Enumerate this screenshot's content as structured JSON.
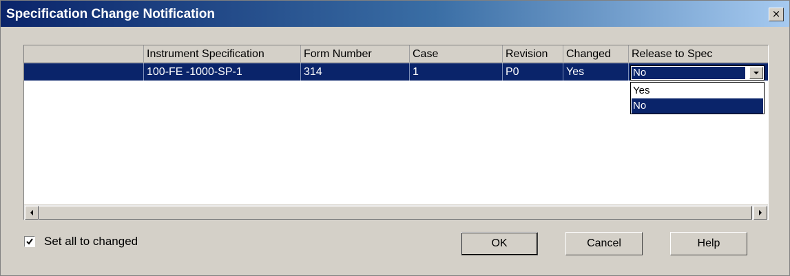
{
  "window": {
    "title": "Specification Change Notification",
    "close_label": "×"
  },
  "grid": {
    "columns": [
      "",
      "Instrument Specification",
      "Form Number",
      "Case",
      "Revision",
      "Changed",
      "Release to Spec"
    ],
    "rows": [
      {
        "instrument_specification": "100-FE  -1000-SP-1",
        "form_number": "314",
        "case": "1",
        "revision": "P0",
        "changed": "Yes",
        "release_to_spec": "No"
      }
    ]
  },
  "dropdown": {
    "selected": "No",
    "options": [
      "Yes",
      "No"
    ]
  },
  "footer": {
    "set_all_label": "Set all to changed",
    "set_all_checked": true,
    "ok_label": "OK",
    "cancel_label": "Cancel",
    "help_label": "Help"
  },
  "colors": {
    "selection": "#0a246a",
    "face": "#d4d0c8"
  },
  "icons": {
    "close": "close-icon",
    "dropdown": "chevron-down-icon",
    "scroll_left": "scroll-left-arrow-icon",
    "scroll_right": "scroll-right-arrow-icon",
    "check": "checkmark-icon"
  }
}
